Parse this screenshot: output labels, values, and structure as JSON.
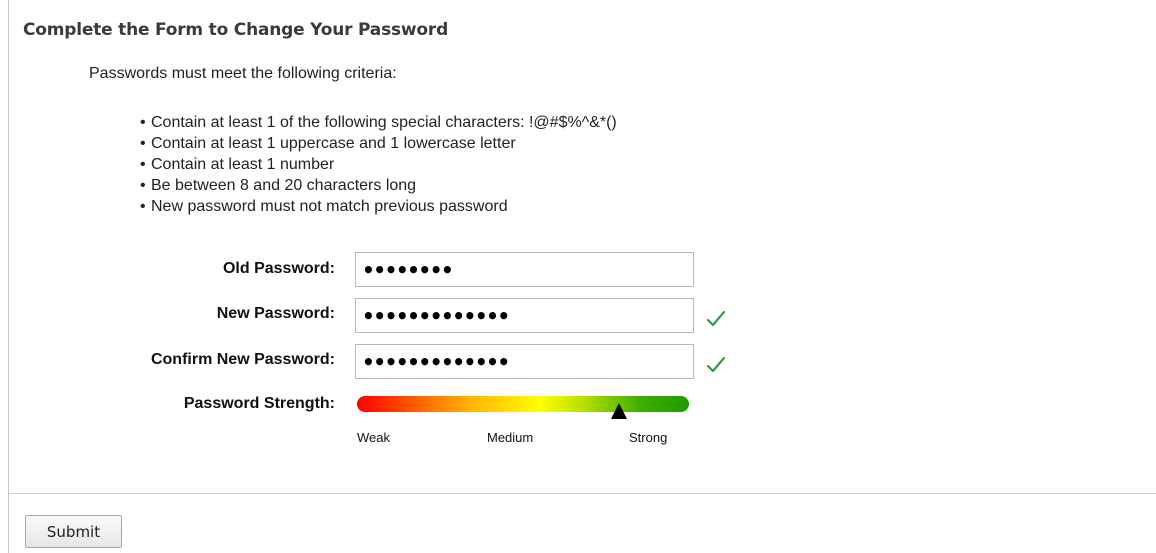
{
  "form": {
    "title": "Complete the Form to Change Your Password",
    "criteria_intro": "Passwords must meet the following criteria:",
    "criteria": [
      "Contain at least 1 of the following special characters: !@#$%^&*()",
      "Contain at least 1 uppercase and 1 lowercase letter",
      "Contain at least 1 number",
      "Be between 8 and 20 characters long",
      "New password must not match previous password"
    ]
  },
  "fields": {
    "old_password": {
      "label": "Old Password:",
      "value": "••••••••"
    },
    "new_password": {
      "label": "New Password:",
      "value": "•••••••••••••",
      "valid_icon": "check-icon"
    },
    "confirm_password": {
      "label": "Confirm New Password:",
      "value": "•••••••••••••",
      "valid_icon": "check-icon"
    }
  },
  "strength": {
    "label": "Password Strength:",
    "level": 0.79,
    "scale": [
      "Weak",
      "Medium",
      "Strong"
    ]
  },
  "colors": {
    "check": "#2ea043",
    "weak": "#ff0000",
    "medium": "#ffff00",
    "strong": "#1e9a00"
  },
  "actions": {
    "submit_label": "Submit"
  }
}
